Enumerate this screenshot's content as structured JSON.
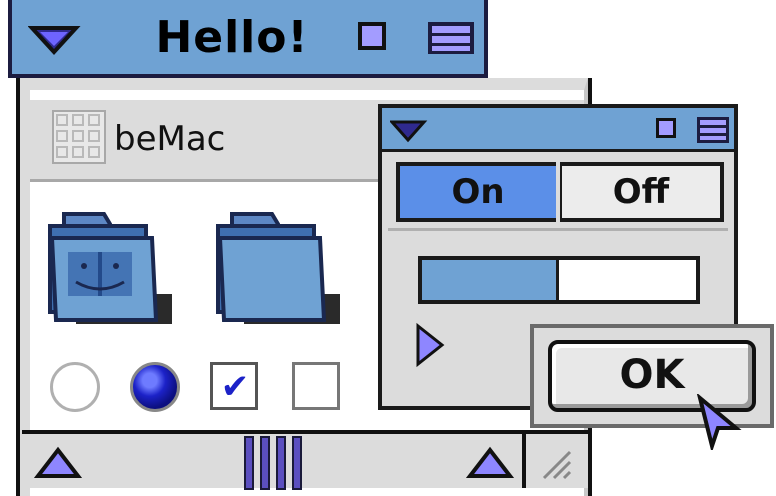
{
  "main_window": {
    "title": "Hello!",
    "header": {
      "title": "beMac"
    },
    "folders": [
      {
        "name": "finder-folder"
      },
      {
        "name": "plain-folder"
      }
    ],
    "controls": {
      "radio_unselected": {
        "checked": false
      },
      "radio_selected": {
        "checked": true
      },
      "checkbox_checked": {
        "checked": true,
        "mark": "✔"
      },
      "checkbox_unchecked": {
        "checked": false
      }
    }
  },
  "dialog": {
    "segmented": {
      "on_label": "On",
      "off_label": "Off",
      "selected": "On"
    },
    "progress": {
      "fraction": 0.5
    }
  },
  "ok_button": {
    "label": "OK"
  },
  "colors": {
    "title_blue": "#6fa2d3",
    "accent_purple": "#5b4fc0",
    "selected_blue": "#5b8fe8",
    "radio_blue": "#1c22c8"
  }
}
